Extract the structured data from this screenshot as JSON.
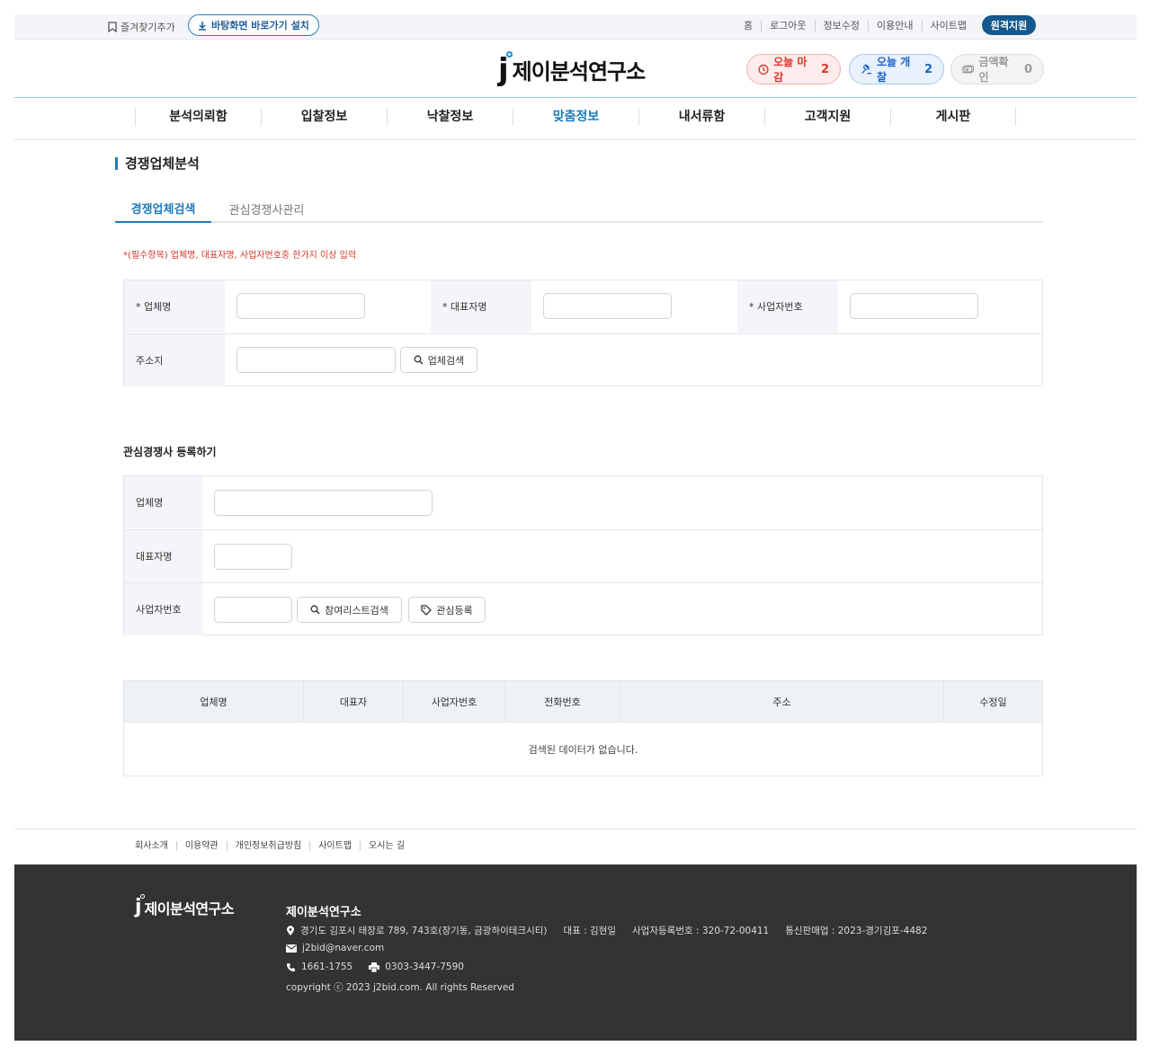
{
  "topbar": {
    "favorite": "즐겨찾기추가",
    "install": "바탕화면 바로가기 설치",
    "links": [
      "홈",
      "로그아웃",
      "정보수정",
      "이용안내",
      "사이트맵"
    ],
    "remote": "원격지원"
  },
  "header": {
    "logo_text": "제이분석연구소",
    "pills": [
      {
        "label": "오늘 마감",
        "count": "2",
        "icon": "clock-icon"
      },
      {
        "label": "오늘 개찰",
        "count": "2",
        "icon": "gavel-icon"
      },
      {
        "label": "금액확인",
        "count": "0",
        "icon": "money-icon"
      }
    ]
  },
  "nav": {
    "items": [
      "분석의뢰함",
      "입찰정보",
      "낙찰정보",
      "맞춤정보",
      "내서류함",
      "고객지원",
      "게시판"
    ],
    "active_index": 3
  },
  "page": {
    "title": "경쟁업체분석",
    "tabs": [
      "경쟁업체검색",
      "관심경쟁사관리"
    ],
    "required_note": "*(필수항목) 업체명, 대표자명, 사업자번호중 한가지 이상 입력"
  },
  "search_form": {
    "company_label": "* 업체명",
    "ceo_label": "* 대표자명",
    "bizno_label": "* 사업자번호",
    "address_label": "주소지",
    "search_button": "업체검색"
  },
  "register_form": {
    "title": "관심경쟁사 등록하기",
    "company_label": "업체명",
    "ceo_label": "대표자명",
    "bizno_label": "사업자번호",
    "participant_search_button": "참여리스트검색",
    "register_button": "관심등록"
  },
  "results": {
    "columns": [
      "업체명",
      "대표자",
      "사업자번호",
      "전화번호",
      "주소",
      "수정일"
    ],
    "empty_message": "검색된 데이터가 없습니다."
  },
  "footer": {
    "links": [
      "회사소개",
      "이용약관",
      "개인정보취급방침",
      "사이트맵",
      "오시는 길"
    ],
    "logo_text": "제이분석연구소",
    "company": "제이분석연구소",
    "address": "경기도 김포시 태장로 789, 743호(장기동, 금광하이테크시티)",
    "ceo": "대표 : 김현일",
    "biz_reg": "사업자등록번호 : 320-72-00411",
    "mail_order": "통신판매업 : 2023-경기김포-4482",
    "email": "j2bid@naver.com",
    "phone": "1661-1755",
    "fax": "0303-3447-7590",
    "copyright": "copyright ⓒ 2023 j2bid.com. All rights Reserved"
  },
  "colors": {
    "accent": "#1d7bbd",
    "remote_button": "#14588e",
    "footer_bg": "#333333",
    "required_text": "#d9362b"
  }
}
